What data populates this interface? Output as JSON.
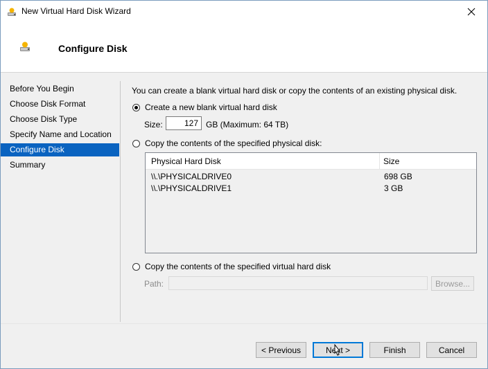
{
  "window": {
    "title": "New Virtual Hard Disk Wizard"
  },
  "header": {
    "title": "Configure Disk"
  },
  "nav": {
    "items": [
      {
        "label": "Before You Begin",
        "active": false
      },
      {
        "label": "Choose Disk Format",
        "active": false
      },
      {
        "label": "Choose Disk Type",
        "active": false
      },
      {
        "label": "Specify Name and Location",
        "active": false
      },
      {
        "label": "Configure Disk",
        "active": true
      },
      {
        "label": "Summary",
        "active": false
      }
    ]
  },
  "content": {
    "intro": "You can create a blank virtual hard disk or copy the contents of an existing physical disk.",
    "option_new": {
      "label": "Create a new blank virtual hard disk",
      "checked": true
    },
    "size": {
      "label": "Size:",
      "value": "127",
      "unit": "GB (Maximum: 64 TB)"
    },
    "option_physical": {
      "label": "Copy the contents of the specified physical disk:",
      "checked": false
    },
    "disk_table": {
      "columns": [
        "Physical Hard Disk",
        "Size"
      ],
      "rows": [
        {
          "disk": "\\\\.\\PHYSICALDRIVE0",
          "size": "698 GB"
        },
        {
          "disk": "\\\\.\\PHYSICALDRIVE1",
          "size": "3 GB"
        }
      ]
    },
    "option_virtual": {
      "label": "Copy the contents of the specified virtual hard disk",
      "checked": false
    },
    "path": {
      "label": "Path:",
      "value": ""
    },
    "browse_label": "Browse..."
  },
  "footer": {
    "previous_label": "< Previous",
    "next_label": "Next >",
    "finish_label": "Finish",
    "cancel_label": "Cancel"
  },
  "colors": {
    "accent": "#0a63c0",
    "default_button_border": "#0078d7"
  },
  "icons": {
    "app": "virtual-disk-icon",
    "close": "close-icon"
  }
}
